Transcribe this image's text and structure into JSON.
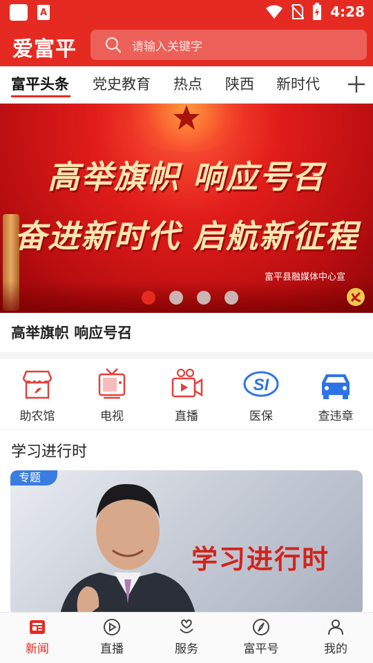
{
  "status_bar": {
    "time": "4:28",
    "app_badge": "A"
  },
  "header": {
    "logo": "爱富平",
    "search_placeholder": "请输入关键字"
  },
  "tabs": [
    {
      "label": "富平头条",
      "active": true
    },
    {
      "label": "党史教育"
    },
    {
      "label": "热点"
    },
    {
      "label": "陕西"
    },
    {
      "label": "新时代"
    }
  ],
  "banner": {
    "line1": "高举旗帜 响应号召",
    "line2": "奋进新时代 启航新征程",
    "credit": "富平县融媒体中心宣",
    "slide_count": 4,
    "active_slide": 1,
    "caption": "高举旗帜 响应号召"
  },
  "services": [
    {
      "label": "助农馆",
      "icon": "shop-icon"
    },
    {
      "label": "电视",
      "icon": "tv-icon"
    },
    {
      "label": "直播",
      "icon": "video-camera-icon"
    },
    {
      "label": "医保",
      "icon": "si-insurance-icon"
    },
    {
      "label": "查违章",
      "icon": "car-icon"
    }
  ],
  "section": {
    "title": "学习进行时",
    "feature_tag": "专题",
    "feature_text": "学习进行时"
  },
  "bottom_nav": [
    {
      "label": "新闻",
      "icon": "news-icon",
      "active": true
    },
    {
      "label": "直播",
      "icon": "play-icon"
    },
    {
      "label": "服务",
      "icon": "service-icon"
    },
    {
      "label": "富平号",
      "icon": "compass-icon"
    },
    {
      "label": "我的",
      "icon": "user-icon"
    }
  ],
  "colors": {
    "brand_red": "#e52b21",
    "tag_blue": "#3a7de0",
    "icon_blue": "#2f74e6"
  }
}
